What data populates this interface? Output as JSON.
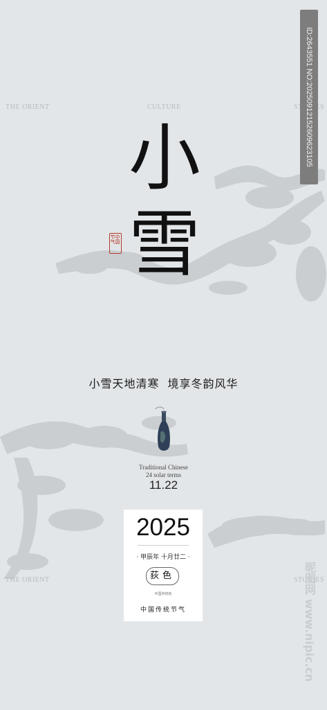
{
  "corners": {
    "top_left": "THE ORIENT",
    "top_center": "CULTURE",
    "top_right": "STORIES",
    "bottom_left": "THE ORIENT",
    "bottom_right": "STORIES"
  },
  "title": {
    "char1": "小",
    "char2": "雪"
  },
  "seal": {
    "col1": "节气",
    "col2": "中国"
  },
  "subtitle": {
    "part1": "小雪天地清寒",
    "part2": "境享冬韵风华"
  },
  "english": {
    "line1": "Traditional Chinese",
    "line2": "24 solar terms"
  },
  "date": "11.22",
  "card": {
    "year": "2025",
    "lunar": "· 甲辰年  十月廿二 ·",
    "color_name": "荻色",
    "color_caption": "中国传统色",
    "footer": "中国传统节气"
  },
  "watermark": {
    "id": "ID:2643551 NO:20250912152609623105",
    "site": "昵图网 www.nipic.cn"
  },
  "colors": {
    "background": "#e3e6e8",
    "ink": "#c4c8cb",
    "seal_red": "#b33a2c",
    "vase": "#2e3f57"
  }
}
